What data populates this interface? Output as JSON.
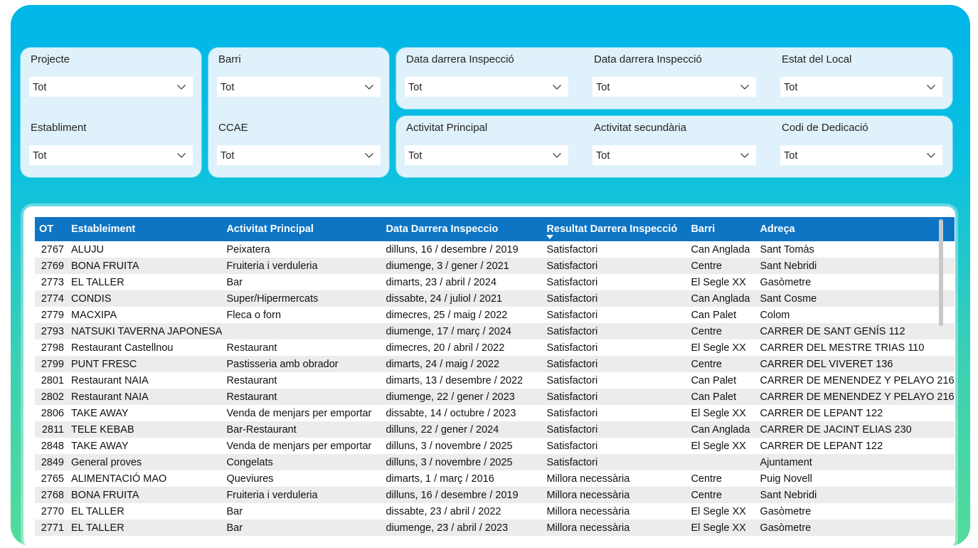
{
  "filters": {
    "projecte": {
      "label": "Projecte",
      "value": "Tot"
    },
    "establiment": {
      "label": "Establiment",
      "value": "Tot"
    },
    "barri": {
      "label": "Barri",
      "value": "Tot"
    },
    "ccae": {
      "label": "CCAE",
      "value": "Tot"
    },
    "data1": {
      "label": "Data darrera Inspecció",
      "value": "Tot"
    },
    "data2": {
      "label": "Data darrera Inspecció",
      "value": "Tot"
    },
    "estat": {
      "label": "Estat del Local",
      "value": "Tot"
    },
    "activitat_principal": {
      "label": "Activitat Principal",
      "value": "Tot"
    },
    "activitat_secundaria": {
      "label": "Activitat secundària",
      "value": "Tot"
    },
    "codi": {
      "label": "Codi de Dedicació",
      "value": "Tot"
    }
  },
  "table": {
    "columns": [
      "OT",
      "Estableiment",
      "Activitat Principal",
      "Data Darrera Inspeccio",
      "Resultat Darrera Inspecció",
      "Barri",
      "Adreça"
    ],
    "sorted_column": "Resultat Darrera Inspecció",
    "rows": [
      [
        "2767",
        "ALUJU",
        "Peixatera",
        "dilluns, 16 / desembre / 2019",
        "Satisfactori",
        "Can Anglada",
        "Sant Tomàs"
      ],
      [
        "2769",
        "BONA FRUITA",
        "Fruiteria i verduleria",
        "diumenge, 3 / gener / 2021",
        "Satisfactori",
        "Centre",
        "Sant Nebridi"
      ],
      [
        "2773",
        "EL TALLER",
        "Bar",
        "dimarts, 23 / abril / 2024",
        "Satisfactori",
        "El Segle XX",
        "Gasòmetre"
      ],
      [
        "2774",
        "CONDIS",
        "Super/Hipermercats",
        "dissabte, 24 / juliol / 2021",
        "Satisfactori",
        "Can Anglada",
        "Sant Cosme"
      ],
      [
        "2779",
        "MACXIPA",
        "Fleca o forn",
        "dimecres, 25 / maig / 2022",
        "Satisfactori",
        "Can Palet",
        "Colom"
      ],
      [
        "2793",
        "NATSUKI TAVERNA JAPONESA",
        "",
        "diumenge, 17 / març / 2024",
        "Satisfactori",
        "Centre",
        "CARRER DE SANT GENÍS 112"
      ],
      [
        "2798",
        "Restaurant Castellnou",
        "Restaurant",
        "dimecres, 20 / abril / 2022",
        "Satisfactori",
        "El Segle XX",
        "CARRER DEL MESTRE TRIAS 110"
      ],
      [
        "2799",
        "PUNT FRESC",
        "Pastisseria amb obrador",
        "dimarts, 24 / maig / 2022",
        "Satisfactori",
        "Centre",
        "CARRER DEL VIVERET 136"
      ],
      [
        "2801",
        "Restaurant NAIA",
        "Restaurant",
        "dimarts, 13 / desembre / 2022",
        "Satisfactori",
        "Can Palet",
        "CARRER DE MENENDEZ Y PELAYO 216"
      ],
      [
        "2802",
        "Restaurant NAIA",
        "Restaurant",
        "diumenge, 22 / gener / 2023",
        "Satisfactori",
        "Can Palet",
        "CARRER DE MENENDEZ Y PELAYO 216"
      ],
      [
        "2806",
        "TAKE AWAY",
        "Venda de menjars per emportar",
        "dissabte, 14 / octubre / 2023",
        "Satisfactori",
        "El Segle XX",
        "CARRER DE LEPANT 122"
      ],
      [
        "2811",
        "TELE KEBAB",
        "Bar-Restaurant",
        "dilluns, 22 / gener / 2024",
        "Satisfactori",
        "Can Anglada",
        "CARRER DE JACINT ELIAS 230"
      ],
      [
        "2848",
        "TAKE AWAY",
        "Venda de menjars per emportar",
        "dilluns, 3 / novembre / 2025",
        "Satisfactori",
        "El Segle XX",
        "CARRER DE LEPANT 122"
      ],
      [
        "2849",
        "General proves",
        "Congelats",
        "dilluns, 3 / novembre / 2025",
        "Satisfactori",
        "",
        "Ajuntament"
      ],
      [
        "2765",
        "ALIMENTACIÓ MAO",
        "Queviures",
        "dimarts, 1 / març / 2016",
        "Millora necessària",
        "Centre",
        "Puig Novell"
      ],
      [
        "2768",
        "BONA FRUITA",
        "Fruiteria i verduleria",
        "dilluns, 16 / desembre / 2019",
        "Millora necessària",
        "Centre",
        "Sant Nebridi"
      ],
      [
        "2770",
        "EL TALLER",
        "Bar",
        "dissabte, 23 / abril / 2022",
        "Millora necessària",
        "El Segle XX",
        "Gasòmetre"
      ],
      [
        "2771",
        "EL TALLER",
        "Bar",
        "diumenge, 23 / abril / 2023",
        "Millora necessària",
        "El Segle XX",
        "Gasòmetre"
      ]
    ]
  },
  "colors": {
    "header": "#0e75c5",
    "card": "#dff1fa",
    "bg_top": "#00b6e8",
    "bg_bottom": "#52dc9a",
    "alt_row": "#ececec"
  }
}
